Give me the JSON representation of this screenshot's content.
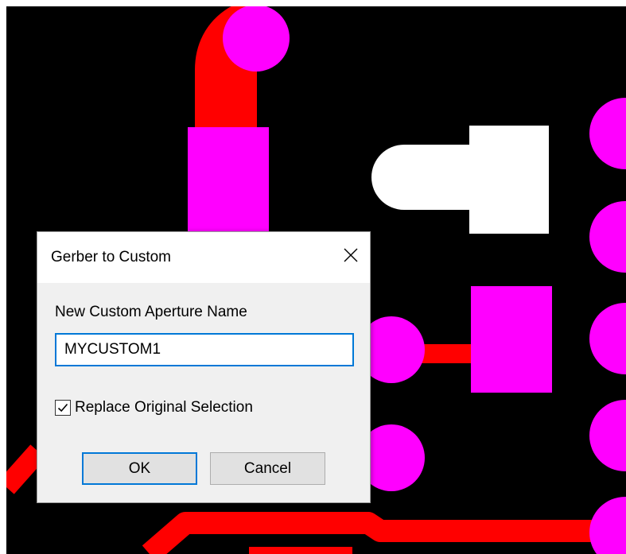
{
  "colors": {
    "board_background": "#000000",
    "trace": "#ff0000",
    "pad": "#ff00ff",
    "selected_pad": "#ffffff",
    "accent": "#0078d7"
  },
  "dialog": {
    "title": "Gerber to Custom",
    "close_icon": "close-icon",
    "field_label": "New Custom Aperture Name",
    "name_value": "MYCUSTOM1",
    "checkbox_label": "Replace Original Selection",
    "checkbox_checked": true,
    "ok_label": "OK",
    "cancel_label": "Cancel"
  }
}
